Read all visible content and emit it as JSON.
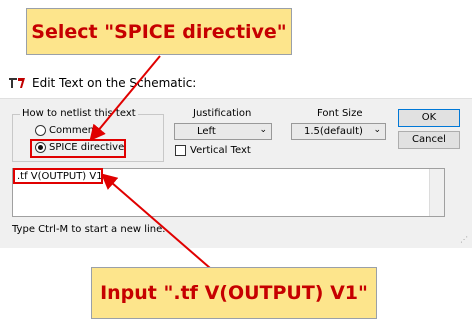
{
  "callouts": {
    "top": "Select \"SPICE directive\"",
    "bottom": "Input \".tf V(OUTPUT) V1\""
  },
  "dialog": {
    "title": "Edit Text on the Schematic:",
    "netlist_group": {
      "label": "How to netlist this text",
      "options": [
        {
          "label": "Comment",
          "selected": false
        },
        {
          "label": "SPICE directive",
          "selected": true
        }
      ]
    },
    "justification": {
      "label": "Justification",
      "value": "Left"
    },
    "vertical_text": {
      "label": "Vertical Text",
      "checked": false
    },
    "font_size": {
      "label": "Font Size",
      "value": "1.5(default)"
    },
    "buttons": {
      "ok": "OK",
      "cancel": "Cancel"
    },
    "text_value": ".tf V(OUTPUT) V1",
    "hint": "Type Ctrl-M to start a new line."
  },
  "colors": {
    "highlight": "#e00000",
    "callout_bg": "#fde58c",
    "callout_text": "#c60000"
  }
}
